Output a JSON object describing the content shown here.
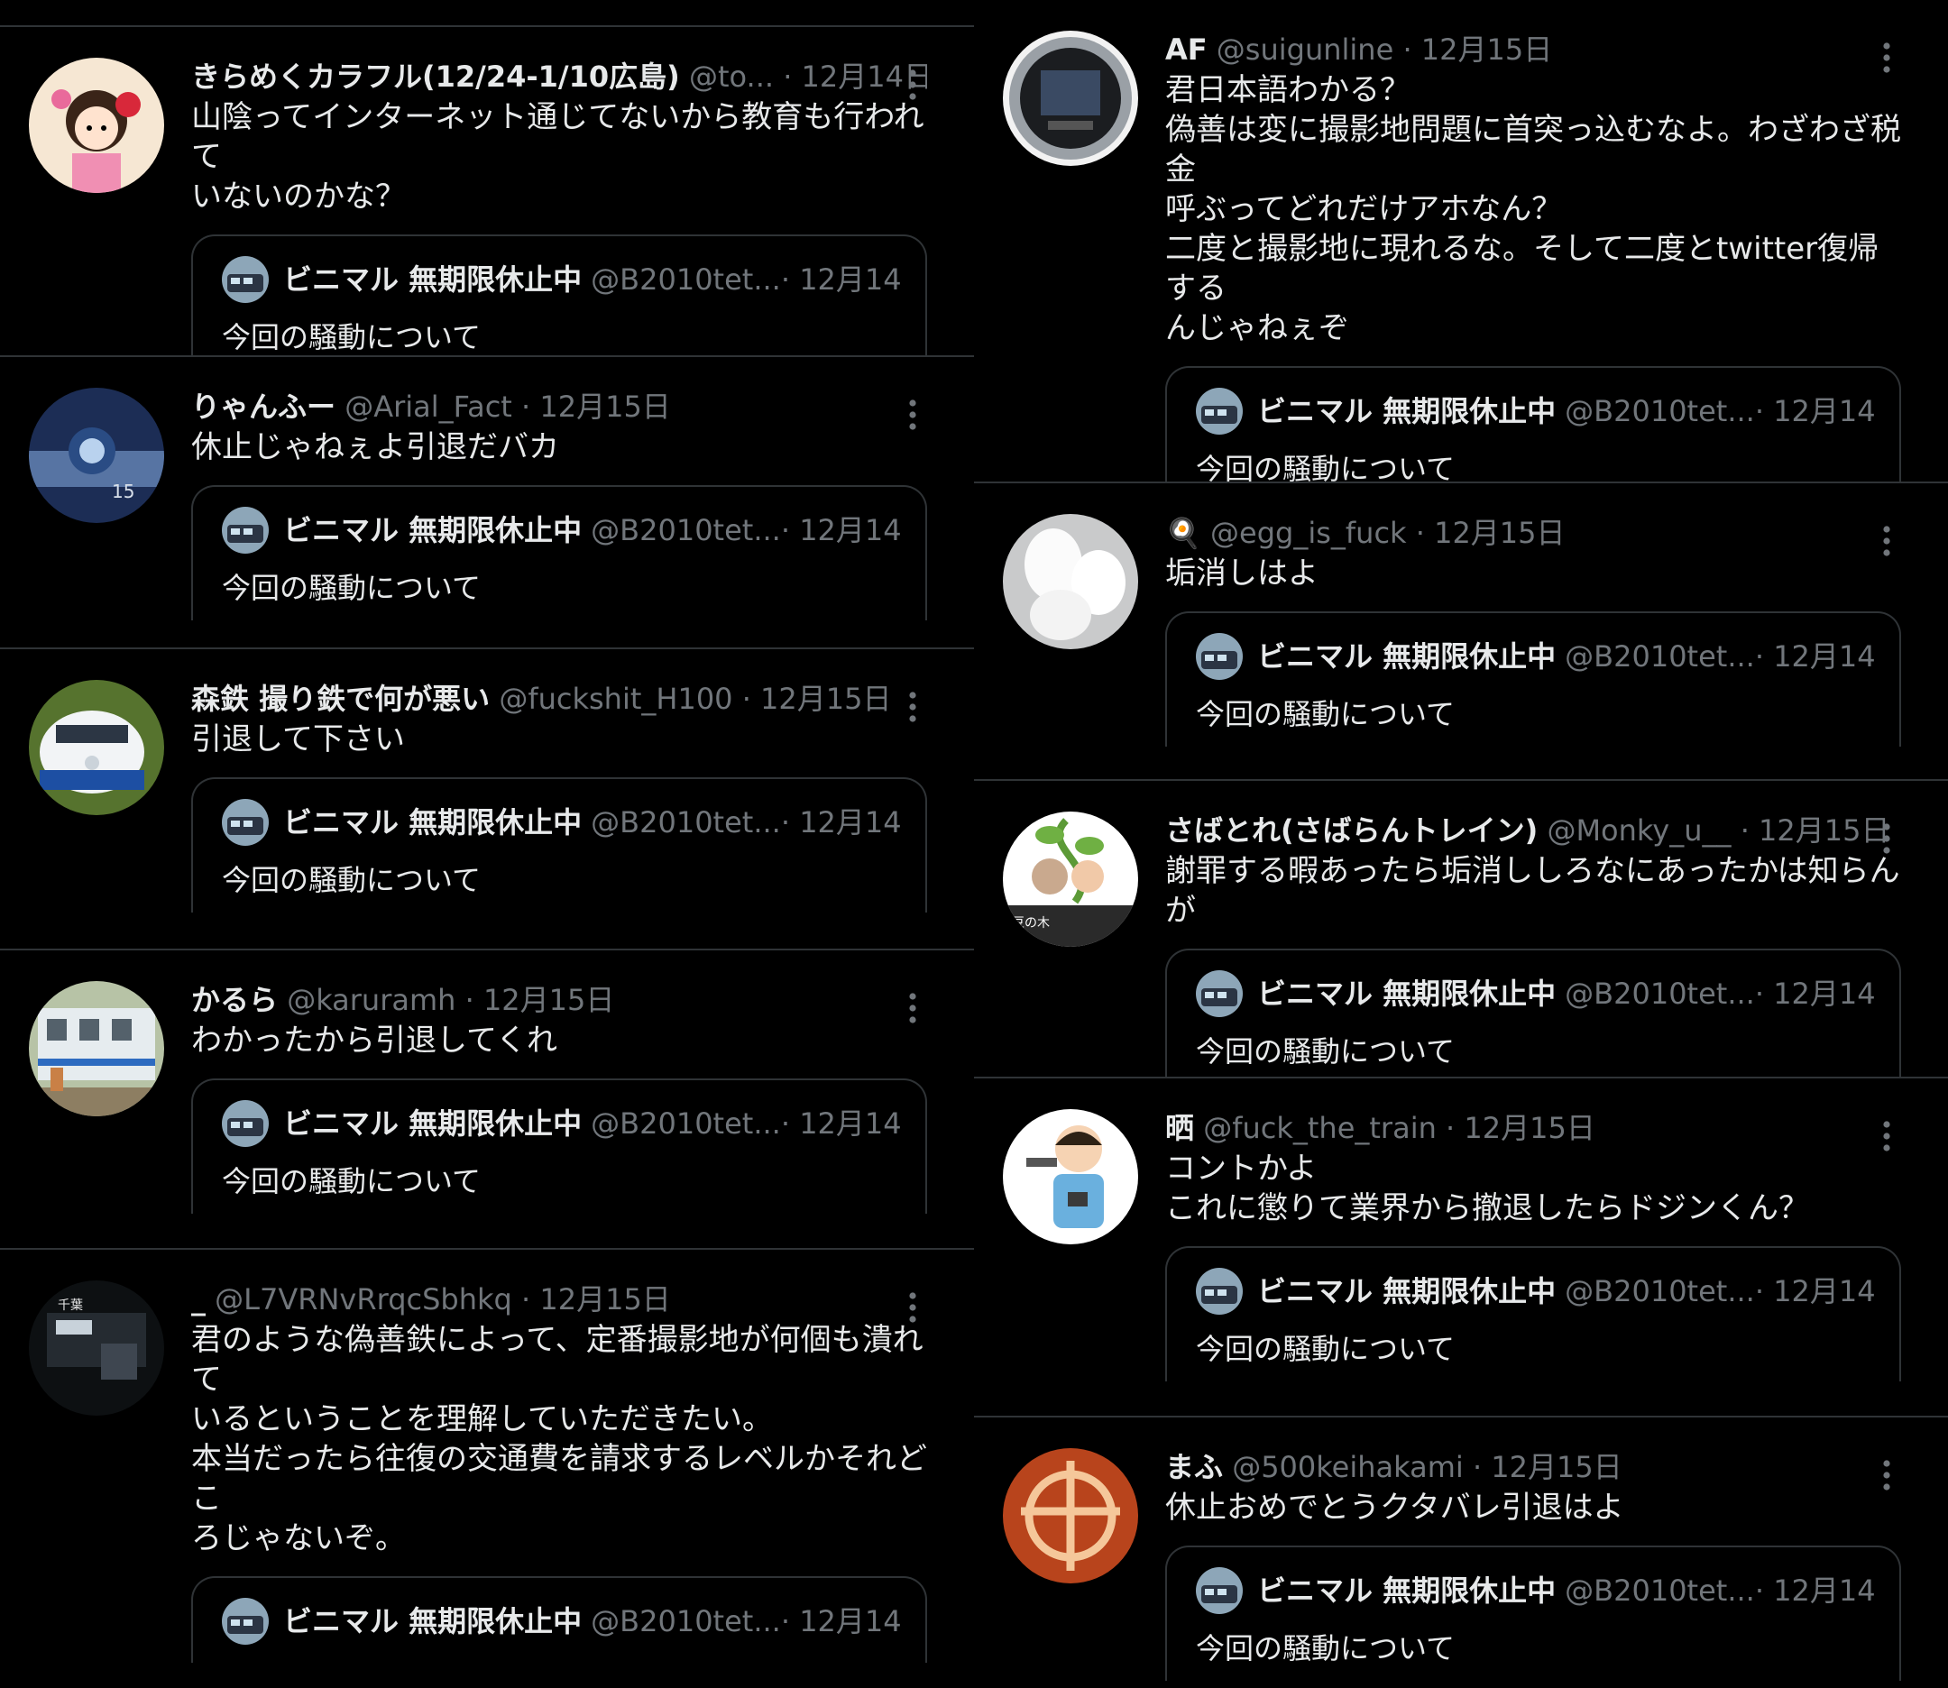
{
  "quoted": {
    "name": "ビニマル 無期限休止中",
    "handle": "@B2010tet...",
    "date": "· 12月14日",
    "text": "今回の騒動について"
  },
  "left_tweets": [
    {
      "name": "きらめくカラフル(12/24-1/10広島)",
      "handle": "@to...",
      "date": "· 12月14日",
      "text": "山陰ってインターネット通じてないから教育も行われて\nいないのかな？"
    },
    {
      "name": "りゃんふー",
      "handle": "@Arial_Fact",
      "date": "· 12月15日",
      "text": "休止じゃねぇよ引退だバカ"
    },
    {
      "name": "森鉄 撮り鉄で何が悪い",
      "handle": "@fuckshit_H100",
      "date": "· 12月15日",
      "text": "引退して下さい"
    },
    {
      "name": "かるら",
      "handle": "@karuramh",
      "date": "· 12月15日",
      "text": "わかったから引退してくれ"
    },
    {
      "name": "_",
      "handle": "@L7VRNvRrqcSbhkq",
      "date": "· 12月15日",
      "text": "君のような偽善鉄によって、定番撮影地が何個も潰れて\nいるということを理解していただきたい。\n本当だったら往復の交通費を請求するレベルかそれどこ\nろじゃないぞ。"
    }
  ],
  "right_tweets": [
    {
      "name": "AF",
      "handle": "@suigunline",
      "date": "· 12月15日",
      "text": "君日本語わかる？\n偽善は変に撮影地問題に首突っ込むなよ。わざわざ税金\n呼ぶってどれだけアホなん？\n二度と撮影地に現れるな。そして二度とtwitter復帰する\nんじゃねぇぞ"
    },
    {
      "name": "🍳",
      "handle": "@egg_is_fuck",
      "date": "· 12月15日",
      "text": "垢消しはよ"
    },
    {
      "name": "さばとれ(さばらんトレイン)",
      "handle": "@Monky_u__",
      "date": "· 12月15日",
      "text": "謝罪する暇あったら垢消ししろなにあったかは知らんが"
    },
    {
      "name": "晒",
      "handle": "@fuck_the_train",
      "date": "· 12月15日",
      "text": "コントかよ\nこれに懲りて業界から撤退したらドジンくん？"
    },
    {
      "name": "まふ",
      "handle": "@500keihakami",
      "date": "· 12月15日",
      "text": "休止おめでとうクタバレ引退はよ"
    }
  ]
}
